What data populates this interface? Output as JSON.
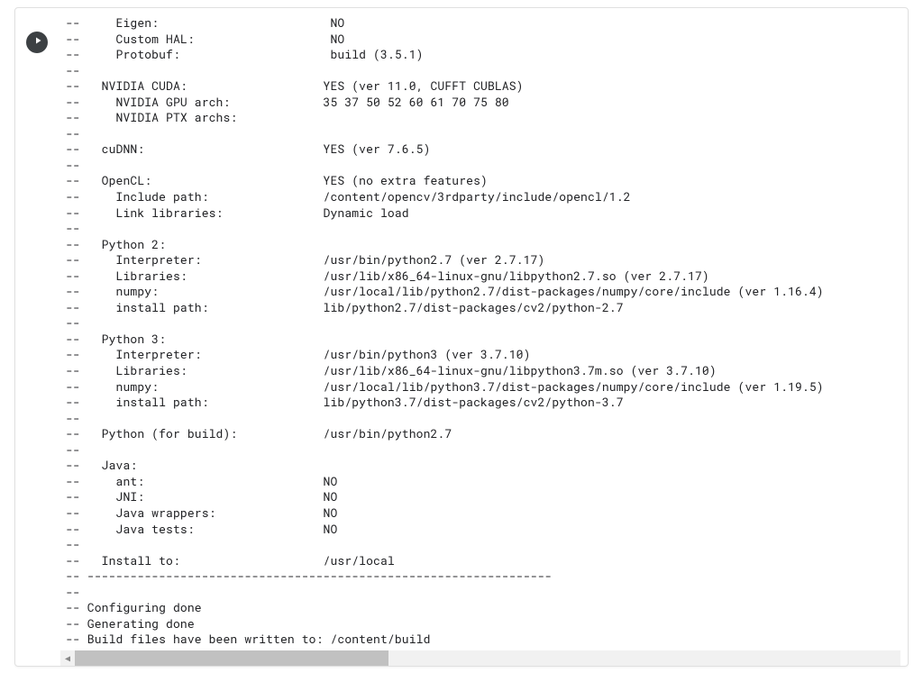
{
  "output": {
    "lines": [
      "--     Eigen:                        NO",
      "--     Custom HAL:                   NO",
      "--     Protobuf:                     build (3.5.1)",
      "-- ",
      "--   NVIDIA CUDA:                   YES (ver 11.0, CUFFT CUBLAS)",
      "--     NVIDIA GPU arch:             35 37 50 52 60 61 70 75 80",
      "--     NVIDIA PTX archs:",
      "-- ",
      "--   cuDNN:                         YES (ver 7.6.5)",
      "-- ",
      "--   OpenCL:                        YES (no extra features)",
      "--     Include path:                /content/opencv/3rdparty/include/opencl/1.2",
      "--     Link libraries:              Dynamic load",
      "-- ",
      "--   Python 2:",
      "--     Interpreter:                 /usr/bin/python2.7 (ver 2.7.17)",
      "--     Libraries:                   /usr/lib/x86_64-linux-gnu/libpython2.7.so (ver 2.7.17)",
      "--     numpy:                       /usr/local/lib/python2.7/dist-packages/numpy/core/include (ver 1.16.4)",
      "--     install path:                lib/python2.7/dist-packages/cv2/python-2.7",
      "-- ",
      "--   Python 3:",
      "--     Interpreter:                 /usr/bin/python3 (ver 3.7.10)",
      "--     Libraries:                   /usr/lib/x86_64-linux-gnu/libpython3.7m.so (ver 3.7.10)",
      "--     numpy:                       /usr/local/lib/python3.7/dist-packages/numpy/core/include (ver 1.19.5)",
      "--     install path:                lib/python3.7/dist-packages/cv2/python-3.7",
      "-- ",
      "--   Python (for build):            /usr/bin/python2.7",
      "-- ",
      "--   Java:                          ",
      "--     ant:                         NO",
      "--     JNI:                         NO",
      "--     Java wrappers:               NO",
      "--     Java tests:                  NO",
      "-- ",
      "--   Install to:                    /usr/local",
      "-- -----------------------------------------------------------------",
      "-- ",
      "-- Configuring done",
      "-- Generating done",
      "-- Build files have been written to: /content/build"
    ]
  },
  "scroll": {
    "left_glyph": "◀"
  }
}
